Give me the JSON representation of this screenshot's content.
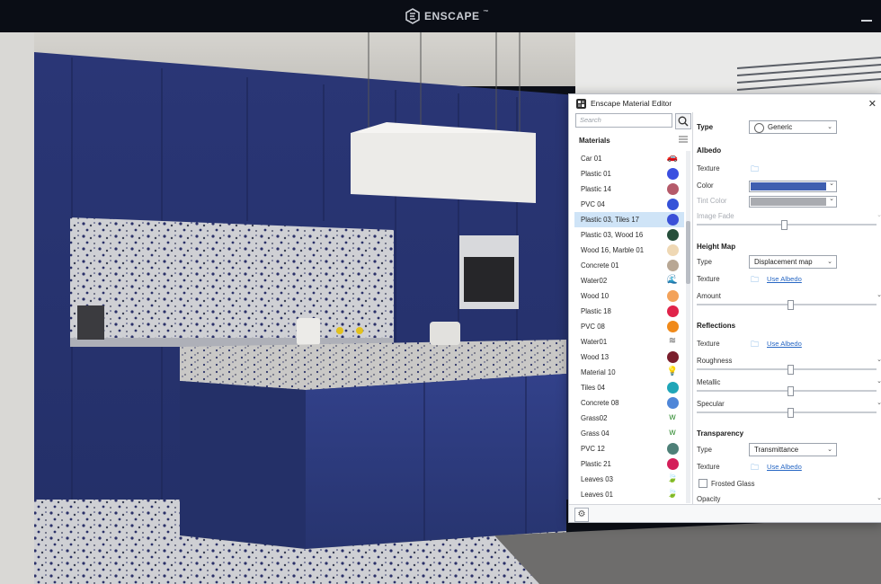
{
  "topbar": {
    "brand": "ENSCAPE",
    "trademark": "™"
  },
  "editor": {
    "title": "Enscape Material Editor",
    "close": "✕",
    "search_placeholder": "Search",
    "materials_header": "Materials",
    "materials": [
      {
        "name": "Car 01",
        "icon": "car-icon",
        "glyph": "🚗",
        "color": "#d11f2a"
      },
      {
        "name": "Plastic 01",
        "color": "#3b4fe0"
      },
      {
        "name": "Plastic 14",
        "color": "#b55a6a"
      },
      {
        "name": "PVC 04",
        "color": "#3552d8"
      },
      {
        "name": "Plastic 03, Tiles 17",
        "color": "#3a50d8",
        "selected": true
      },
      {
        "name": "Plastic 03, Wood 16",
        "color": "#264e3a"
      },
      {
        "name": "Wood 16, Marble 01",
        "color": "#efd8b4"
      },
      {
        "name": "Concrete 01",
        "color": "#b8a794"
      },
      {
        "name": "Water02",
        "icon": "water-icon",
        "glyph": "🌊",
        "color": "#2f6bd6"
      },
      {
        "name": "Wood 10",
        "color": "#f3a25a"
      },
      {
        "name": "Plastic 18",
        "color": "#e0244a"
      },
      {
        "name": "PVC 08",
        "color": "#f08a1a"
      },
      {
        "name": "Water01",
        "icon": "waves-icon",
        "glyph": "≋",
        "color": "#555555"
      },
      {
        "name": "Wood 13",
        "color": "#7a1e2c"
      },
      {
        "name": "Material 10",
        "icon": "lightbulb-icon",
        "glyph": "💡",
        "color": "#e8b85a"
      },
      {
        "name": "Tiles 04",
        "color": "#1fa6b8"
      },
      {
        "name": "Concrete 08",
        "color": "#4f86d8"
      },
      {
        "name": "Grass02",
        "icon": "grass-icon",
        "glyph": "ᴡ",
        "color": "#2e8a2e"
      },
      {
        "name": "Grass 04",
        "icon": "grass-icon",
        "glyph": "ᴡ",
        "color": "#2e8a2e"
      },
      {
        "name": "PVC 12",
        "color": "#4e8078"
      },
      {
        "name": "Plastic 21",
        "color": "#d41f5a"
      },
      {
        "name": "Leaves 03",
        "icon": "leaf-icon",
        "glyph": "🍃",
        "color": "#1f8a3a"
      },
      {
        "name": "Leaves 01",
        "icon": "leaf-icon",
        "glyph": "🍃",
        "color": "#3aa24a"
      }
    ],
    "props": {
      "type_label": "Type",
      "type_value": "Generic",
      "albedo": {
        "title": "Albedo",
        "texture_label": "Texture",
        "color_label": "Color",
        "color_value": "#3f5fb0",
        "tint_label": "Tint Color",
        "tint_value": "#a9abb0",
        "image_fade_label": "Image Fade",
        "image_fade_level": 0.48
      },
      "height_map": {
        "title": "Height Map",
        "type_label": "Type",
        "type_value": "Displacement map",
        "texture_label": "Texture",
        "texture_link": "Use Albedo",
        "amount_label": "Amount",
        "amount_level": 0.52
      },
      "reflections": {
        "title": "Reflections",
        "texture_label": "Texture",
        "texture_link": "Use Albedo",
        "roughness_label": "Roughness",
        "roughness_level": 0.52,
        "metallic_label": "Metallic",
        "metallic_level": 0.52,
        "specular_label": "Specular",
        "specular_level": 0.52
      },
      "transparency": {
        "title": "Transparency",
        "type_label": "Type",
        "type_value": "Transmittance",
        "texture_label": "Texture",
        "texture_link": "Use Albedo",
        "frosted_label": "Frosted Glass",
        "opacity_label": "Opacity"
      }
    }
  }
}
